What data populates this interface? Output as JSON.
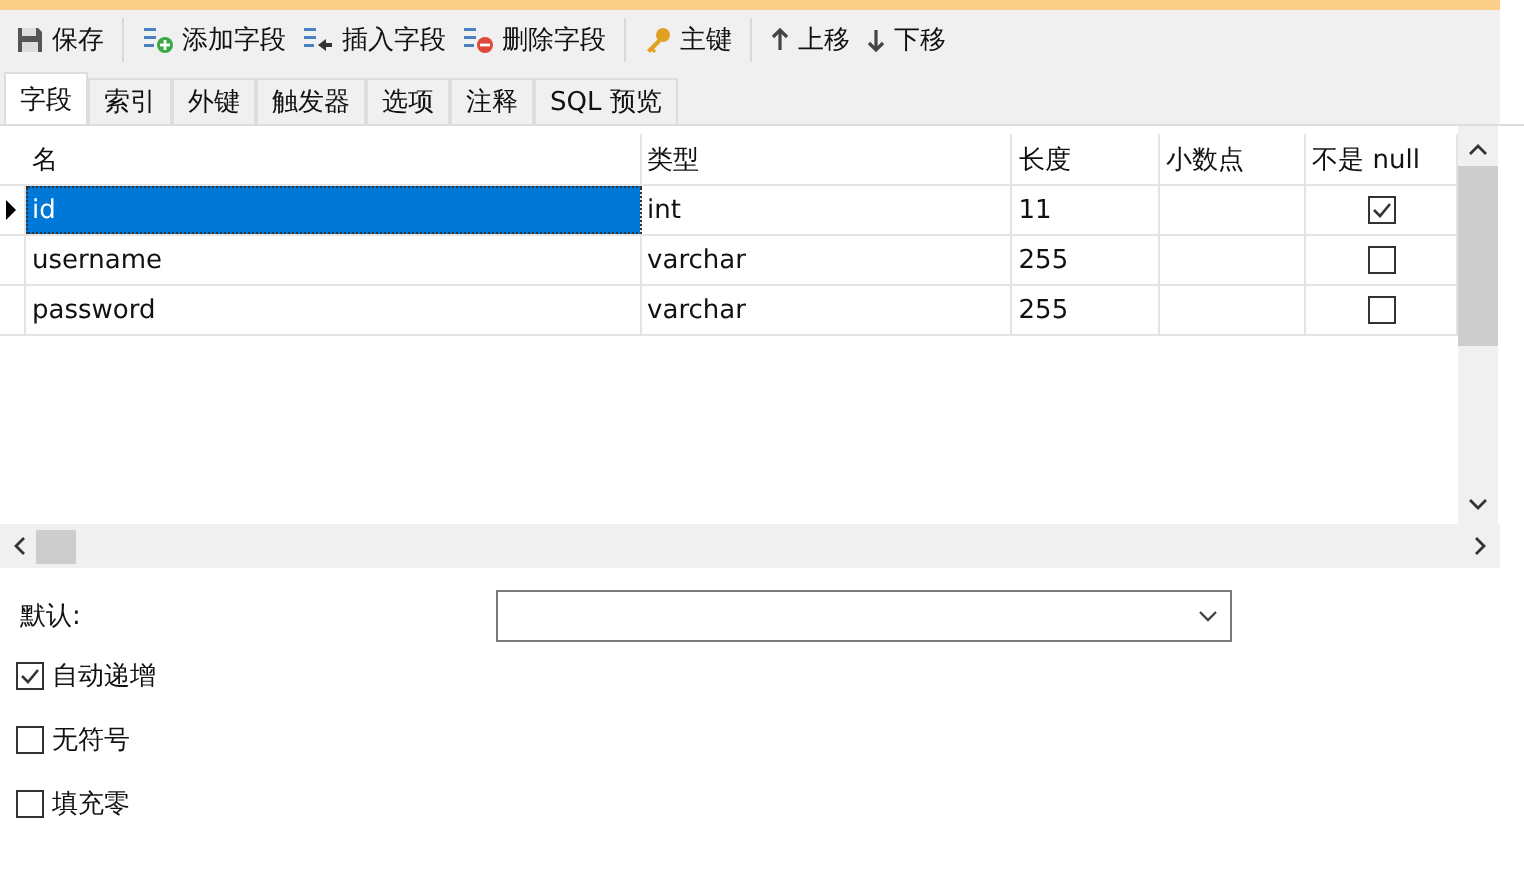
{
  "toolbar": [
    {
      "label": "保存"
    },
    {
      "label": "添加字段"
    },
    {
      "label": "插入字段"
    },
    {
      "label": "删除字段"
    },
    {
      "label": "主键"
    },
    {
      "label": "上移"
    },
    {
      "label": "下移"
    }
  ],
  "tabs": [
    {
      "label": "字段",
      "selected": true
    },
    {
      "label": "索引",
      "selected": false
    },
    {
      "label": "外键",
      "selected": false
    },
    {
      "label": "触发器",
      "selected": false
    },
    {
      "label": "选项",
      "selected": false
    },
    {
      "label": "注释",
      "selected": false
    },
    {
      "label": "SQL 预览",
      "selected": false
    }
  ],
  "table": {
    "columns": [
      "名",
      "类型",
      "长度",
      "小数点",
      "不是 null"
    ],
    "rows": [
      {
        "name": "id",
        "type": "int",
        "length": "11",
        "selected": true,
        "not_null": true
      },
      {
        "name": "username",
        "type": "varchar",
        "length": "255",
        "selected": false,
        "not_null": false
      },
      {
        "name": "password",
        "type": "varchar",
        "length": "255",
        "selected": false,
        "not_null": false
      }
    ]
  },
  "default_label": "默认:",
  "options": [
    {
      "label": "自动递增",
      "checked": true
    },
    {
      "label": "无符号",
      "checked": false
    },
    {
      "label": "填充零",
      "checked": false
    }
  ]
}
